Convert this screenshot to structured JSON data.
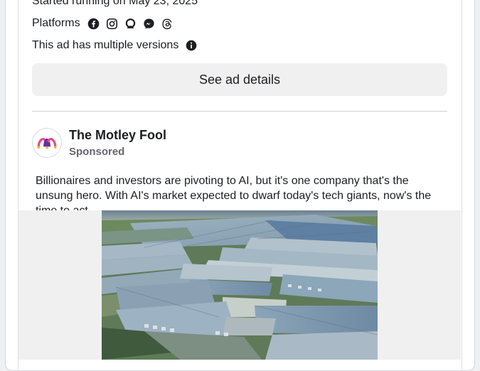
{
  "ad": {
    "started_running": "Started running on May 23, 2025",
    "platforms_label": "Platforms",
    "platform_icons": [
      "facebook-icon",
      "instagram-icon",
      "audience-network-icon",
      "messenger-icon",
      "threads-icon"
    ],
    "versions_text": "This ad has multiple versions",
    "see_details_label": "See ad details"
  },
  "post": {
    "advertiser": "The Motley Fool",
    "sponsored": "Sponsored",
    "body": "Billionaires and investors are pivoting to AI, but it's one company that's the unsung hero. With AI's market expected to dwarf today's tech giants, now's the time to act."
  },
  "colors": {
    "button_bg": "#f0f0f0",
    "secondary_text": "#65676b",
    "primary_text": "#1c1e21"
  }
}
